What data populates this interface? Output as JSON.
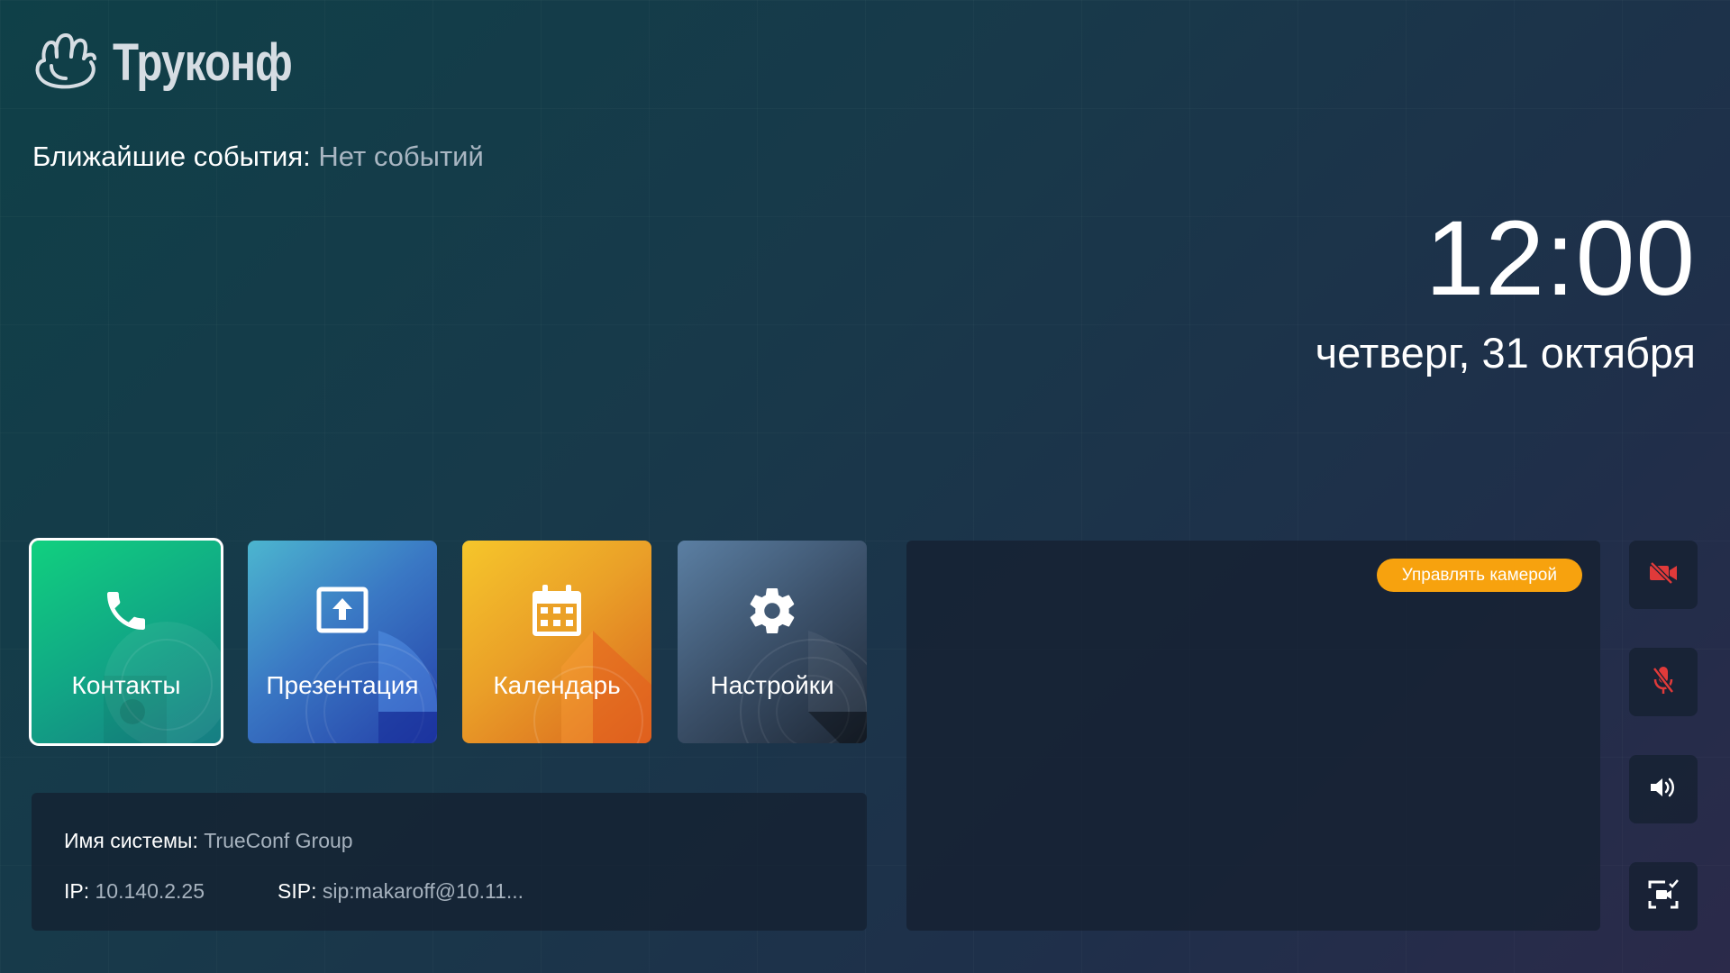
{
  "brand": {
    "logo_text": "Труконф"
  },
  "events": {
    "label": "Ближайшие события:",
    "value": "Нет событий"
  },
  "clock": {
    "time": "12:00",
    "date": "четверг, 31 октября"
  },
  "tiles": [
    {
      "label": "Контакты",
      "icon": "phone-icon",
      "selected": true,
      "color": "#11c280"
    },
    {
      "label": "Презентация",
      "icon": "upload-screen-icon",
      "selected": false,
      "color": "#3a78c4"
    },
    {
      "label": "Календарь",
      "icon": "calendar-icon",
      "selected": false,
      "color": "#eaa028"
    },
    {
      "label": "Настройки",
      "icon": "gear-icon",
      "selected": false,
      "color": "#3b5069"
    }
  ],
  "system_info": {
    "name_label": "Имя системы:",
    "name_value": "TrueConf Group",
    "ip_label": "IP:",
    "ip_value": "10.140.2.25",
    "sip_label": "SIP:",
    "sip_value": "sip:makaroff@10.11..."
  },
  "preview": {
    "camera_control_label": "Управлять камерой",
    "accent": "#f7a20e"
  },
  "side_controls": [
    {
      "icon": "camera-off-icon",
      "color": "#e03a3a"
    },
    {
      "icon": "mic-off-icon",
      "color": "#e03a3a"
    },
    {
      "icon": "speaker-icon",
      "color": "#ffffff"
    },
    {
      "icon": "screen-select-icon",
      "color": "#ffffff"
    }
  ]
}
